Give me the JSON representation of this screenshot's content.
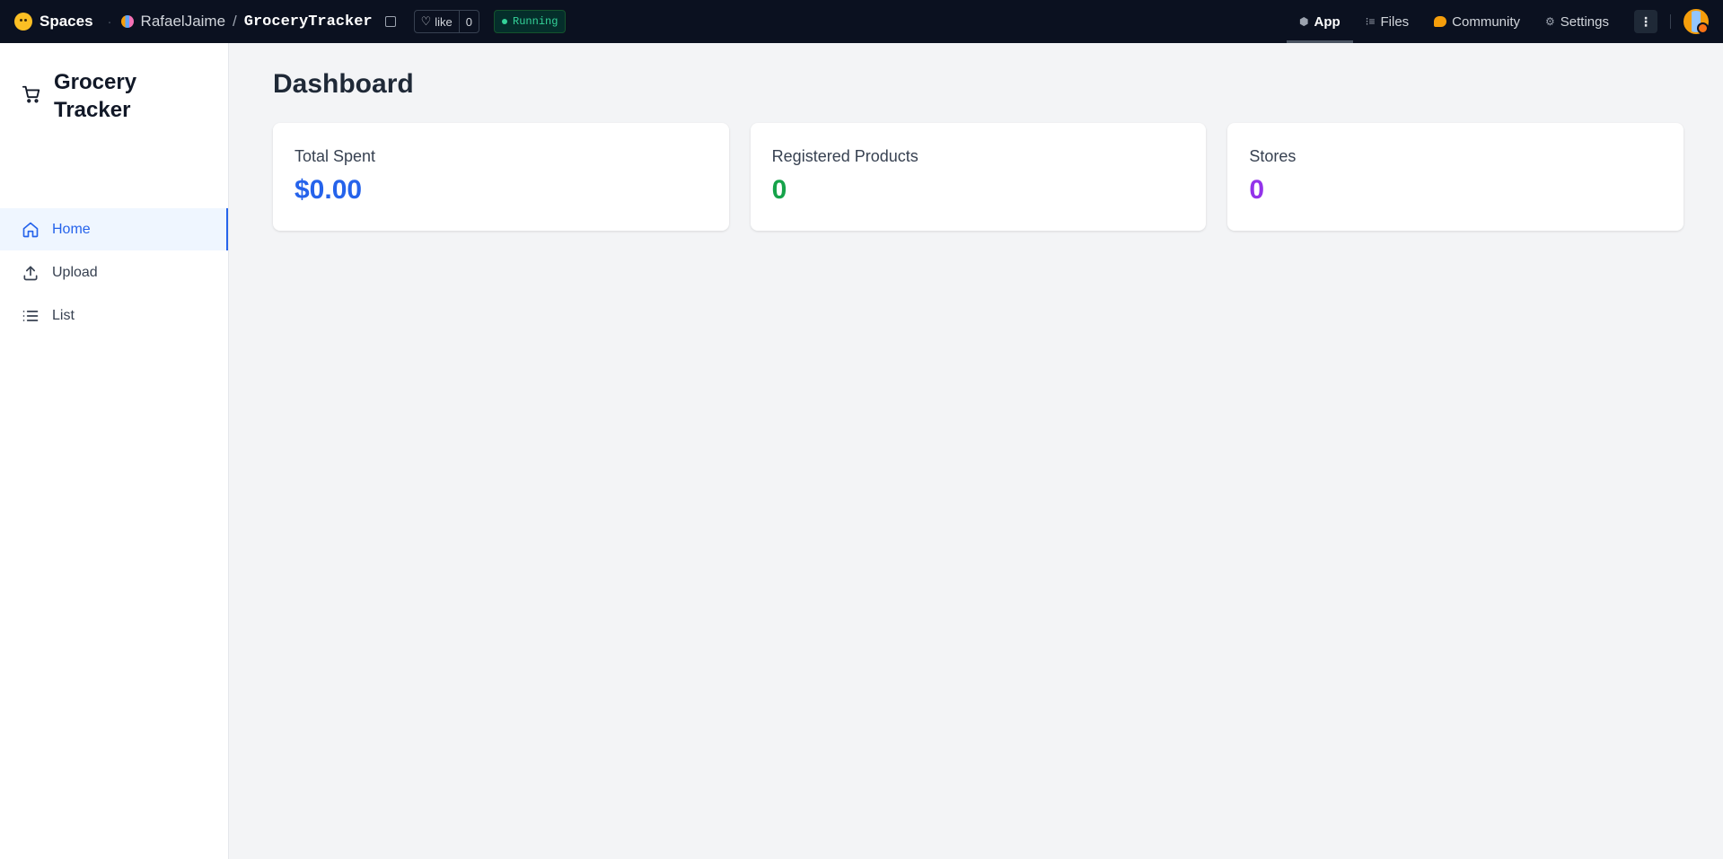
{
  "topbar": {
    "spaces_label": "Spaces",
    "owner": "RafaelJaime",
    "separator": "/",
    "repo": "GroceryTracker",
    "like_label": "like",
    "like_count": "0",
    "status": "Running",
    "tabs": [
      {
        "label": "App",
        "icon": "cube-icon",
        "active": true
      },
      {
        "label": "Files",
        "icon": "files-icon",
        "active": false
      },
      {
        "label": "Community",
        "icon": "community-icon",
        "active": false
      },
      {
        "label": "Settings",
        "icon": "gear-icon",
        "active": false
      }
    ],
    "more_label": "⋮"
  },
  "sidebar": {
    "brand_line1": "Grocery",
    "brand_line2": "Tracker",
    "items": [
      {
        "label": "Home",
        "icon": "home-icon",
        "active": true
      },
      {
        "label": "Upload",
        "icon": "upload-icon",
        "active": false
      },
      {
        "label": "List",
        "icon": "list-icon",
        "active": false
      }
    ]
  },
  "main": {
    "title": "Dashboard",
    "cards": [
      {
        "label": "Total Spent",
        "value": "$0.00",
        "color": "#2563eb"
      },
      {
        "label": "Registered Products",
        "value": "0",
        "color": "#16a34a"
      },
      {
        "label": "Stores",
        "value": "0",
        "color": "#9333ea"
      }
    ]
  }
}
